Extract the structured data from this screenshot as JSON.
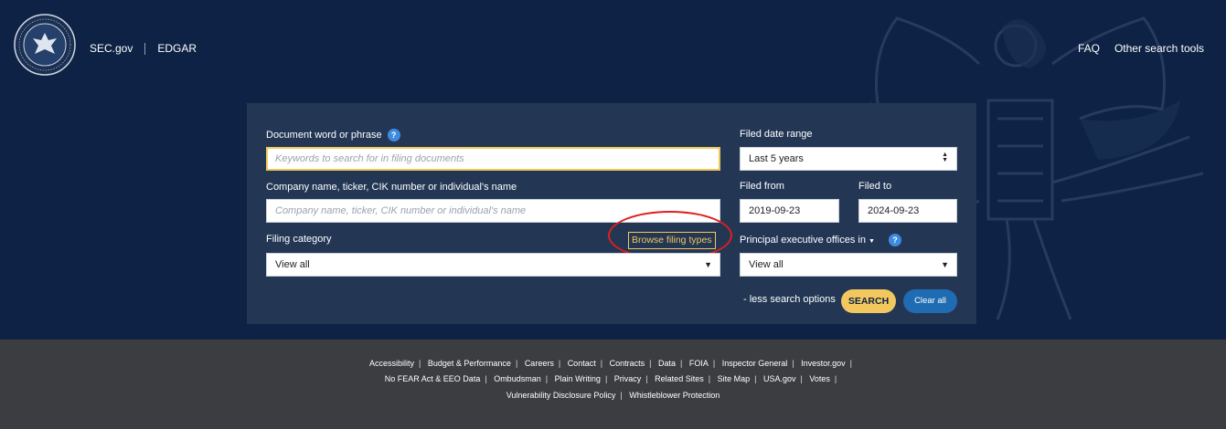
{
  "header": {
    "seal_text": "U.S. SECURITIES AND EXCHANGE COMMISSION · MCMXXXIV",
    "nav_left": [
      "SEC.gov",
      "EDGAR"
    ],
    "nav_right": [
      "FAQ",
      "Other search tools"
    ]
  },
  "form": {
    "document_label": "Document word or phrase",
    "document_placeholder": "Keywords to search for in filing documents",
    "company_label": "Company name, ticker, CIK number or individual's name",
    "company_placeholder": "Company name, ticker, CIK number or individual's name",
    "category_label": "Filing category",
    "category_value": "View all",
    "browse_link": "Browse filing types",
    "date_range_label": "Filed date range",
    "date_range_value": "Last 5 years",
    "filed_from_label": "Filed from",
    "filed_from_value": "2019-09-23",
    "filed_to_label": "Filed to",
    "filed_to_value": "2024-09-23",
    "location_label": "Principal executive offices in",
    "location_value": "View all",
    "less_options": "- less search options",
    "search_button": "SEARCH",
    "clear_button": "Clear all",
    "help_glyph": "?"
  },
  "footer": {
    "row1": [
      "Accessibility",
      "Budget & Performance",
      "Careers",
      "Contact",
      "Contracts",
      "Data",
      "FOIA",
      "Inspector General",
      "Investor.gov"
    ],
    "row2": [
      "No FEAR Act & EEO Data",
      "Ombudsman",
      "Plain Writing",
      "Privacy",
      "Related Sites",
      "Site Map",
      "USA.gov",
      "Votes"
    ],
    "row3": [
      "Vulnerability Disclosure Policy",
      "Whistleblower Protection"
    ]
  },
  "colors": {
    "hero_bg": "#0d2244",
    "panel_bg": "#233755",
    "accent_yellow": "#f2c85e",
    "clear_blue": "#1f6cb3",
    "highlight_red": "#e01e1e",
    "footer_bg": "#3c3d40"
  }
}
